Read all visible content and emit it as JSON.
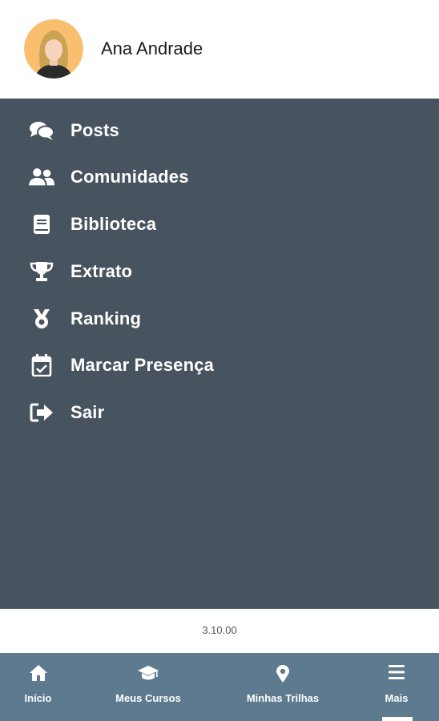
{
  "user": {
    "name": "Ana Andrade"
  },
  "menu": {
    "items": [
      {
        "label": "Posts",
        "icon": "comments-icon"
      },
      {
        "label": "Comunidades",
        "icon": "users-icon"
      },
      {
        "label": "Biblioteca",
        "icon": "book-icon"
      },
      {
        "label": "Extrato",
        "icon": "trophy-icon"
      },
      {
        "label": "Ranking",
        "icon": "medal-icon"
      },
      {
        "label": "Marcar Presença",
        "icon": "calendar-check-icon"
      },
      {
        "label": "Sair",
        "icon": "sign-out-icon"
      }
    ]
  },
  "version": "3.10.00",
  "bottom_nav": {
    "items": [
      {
        "label": "Início",
        "icon": "home-icon"
      },
      {
        "label": "Meus Cursos",
        "icon": "graduation-cap-icon"
      },
      {
        "label": "Minhas Trilhas",
        "icon": "map-marker-icon"
      },
      {
        "label": "Mais",
        "icon": "hamburger-menu-icon",
        "active": true
      }
    ]
  },
  "colors": {
    "menu_background": "#47545f",
    "bottom_nav_background": "#5e7a8f",
    "avatar_background": "#f9bf6f",
    "text_white": "#ffffff"
  }
}
